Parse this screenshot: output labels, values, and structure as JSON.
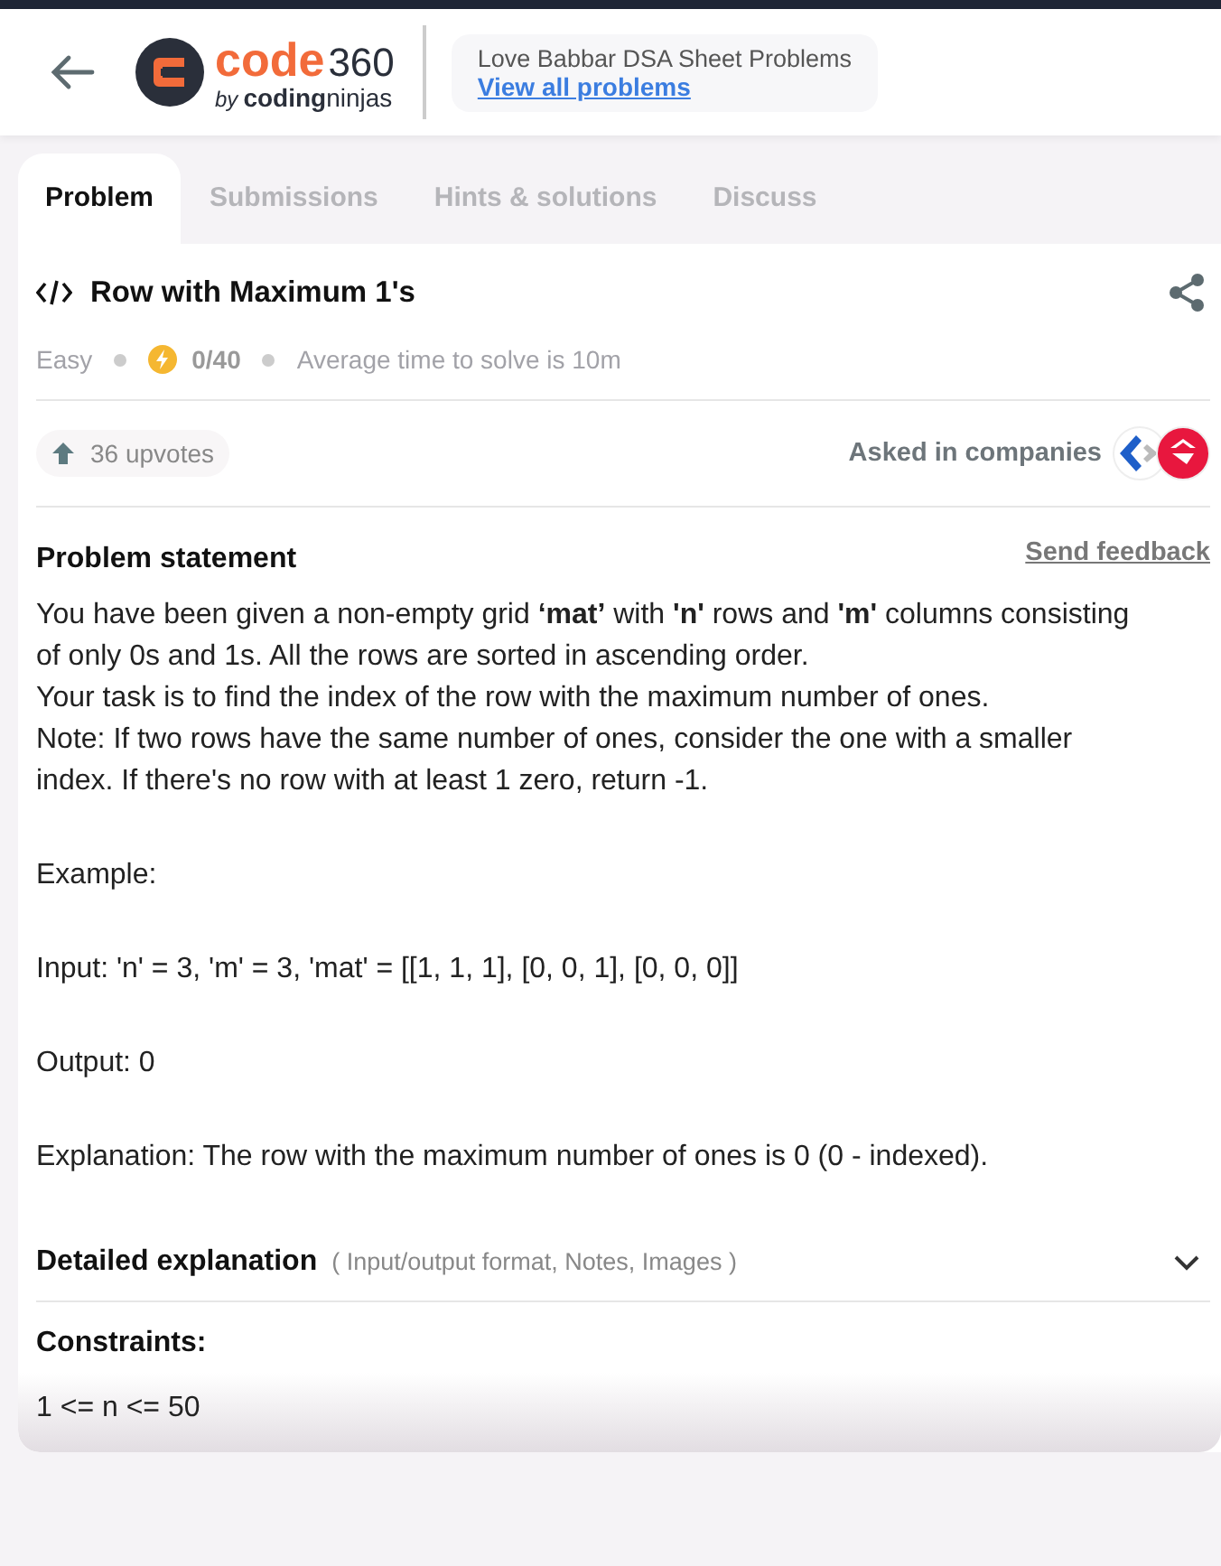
{
  "header": {
    "logo_text": "code",
    "logo_number": "360",
    "logo_by": "by",
    "logo_brand_bold": "coding",
    "logo_brand_light": "ninjas",
    "sheet_title": "Love Babbar DSA Sheet Problems",
    "sheet_link": "View all problems"
  },
  "tabs": [
    {
      "label": "Problem",
      "selected": true
    },
    {
      "label": "Submissions",
      "selected": false
    },
    {
      "label": "Hints & solutions",
      "selected": false
    },
    {
      "label": "Discuss",
      "selected": false
    }
  ],
  "problem": {
    "title": "Row with Maximum 1's",
    "difficulty": "Easy",
    "score": "0/40",
    "avg_time": "Average time to solve is 10m",
    "upvotes": "36 upvotes",
    "companies_label": "Asked in companies"
  },
  "statement": {
    "heading": "Problem statement",
    "feedback_link": "Send feedback",
    "paragraphs": [
      "You have been given a non-empty grid **‘mat’** with **'n'** rows and **'m'** columns consisting of only 0s and 1s. All the rows are sorted in ascending order.",
      "Your task is to find the index of the row with the maximum number of ones.",
      "Note: If two rows have the same number of ones, consider the one with a smaller index. If there's no row with at least 1 zero, return -1."
    ],
    "example_lines": [
      "Example:",
      "Input: 'n' = 3, 'm' = 3, 'mat' = [[1, 1, 1], [0, 0, 1], [0, 0, 0]]",
      "Output: 0",
      "Explanation: The row with the maximum number of ones is 0 (0 - indexed)."
    ]
  },
  "details": {
    "title": "Detailed explanation",
    "hint": "( Input/output format, Notes, Images )",
    "expanded": false
  },
  "constraints": {
    "heading": "Constraints:",
    "lines": [
      "1 <= n <= 50"
    ]
  }
}
